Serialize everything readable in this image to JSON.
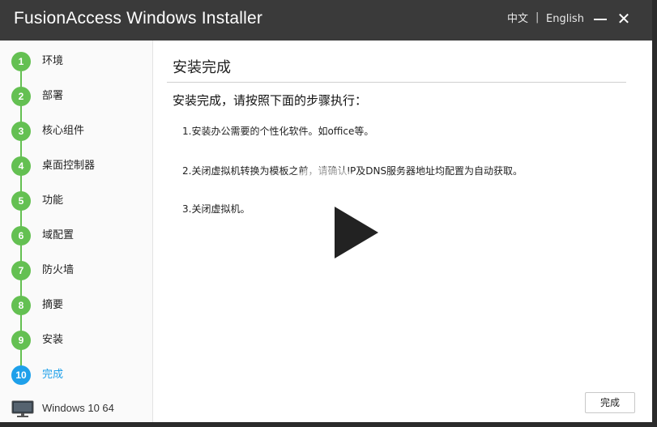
{
  "window": {
    "title": "FusionAccess Windows Installer"
  },
  "language": {
    "chinese": "中文",
    "separator": "|",
    "english": "English"
  },
  "window_controls": {
    "minimize_icon": "minimize-icon",
    "close_icon": "close-icon",
    "close_glyph": "✕"
  },
  "sidebar": {
    "steps": [
      {
        "number": "1",
        "label": "环境",
        "active": false
      },
      {
        "number": "2",
        "label": "部署",
        "active": false
      },
      {
        "number": "3",
        "label": "核心组件",
        "active": false
      },
      {
        "number": "4",
        "label": "桌面控制器",
        "active": false
      },
      {
        "number": "5",
        "label": "功能",
        "active": false
      },
      {
        "number": "6",
        "label": "域配置",
        "active": false
      },
      {
        "number": "7",
        "label": "防火墙",
        "active": false
      },
      {
        "number": "8",
        "label": "摘要",
        "active": false
      },
      {
        "number": "9",
        "label": "安装",
        "active": false
      },
      {
        "number": "10",
        "label": "完成",
        "active": true
      }
    ],
    "os": {
      "icon": "monitor-icon",
      "label": "Windows 10 64"
    }
  },
  "main": {
    "heading": "安装完成",
    "intro": "安装完成，请按照下面的步骤执行：",
    "instructions": [
      "1.安装办公需要的个性化软件。如office等。",
      "2.关闭虚拟机转换为模板之前，请确认IP及DNS服务器地址均配置为自动获取。",
      "3.关闭虚拟机。"
    ],
    "finish_button": "完成"
  },
  "overlay": {
    "icon": "play-icon"
  },
  "colors": {
    "titlebar": "#3a3a3a",
    "step_done": "#64c052",
    "step_active": "#1ea0ea"
  }
}
